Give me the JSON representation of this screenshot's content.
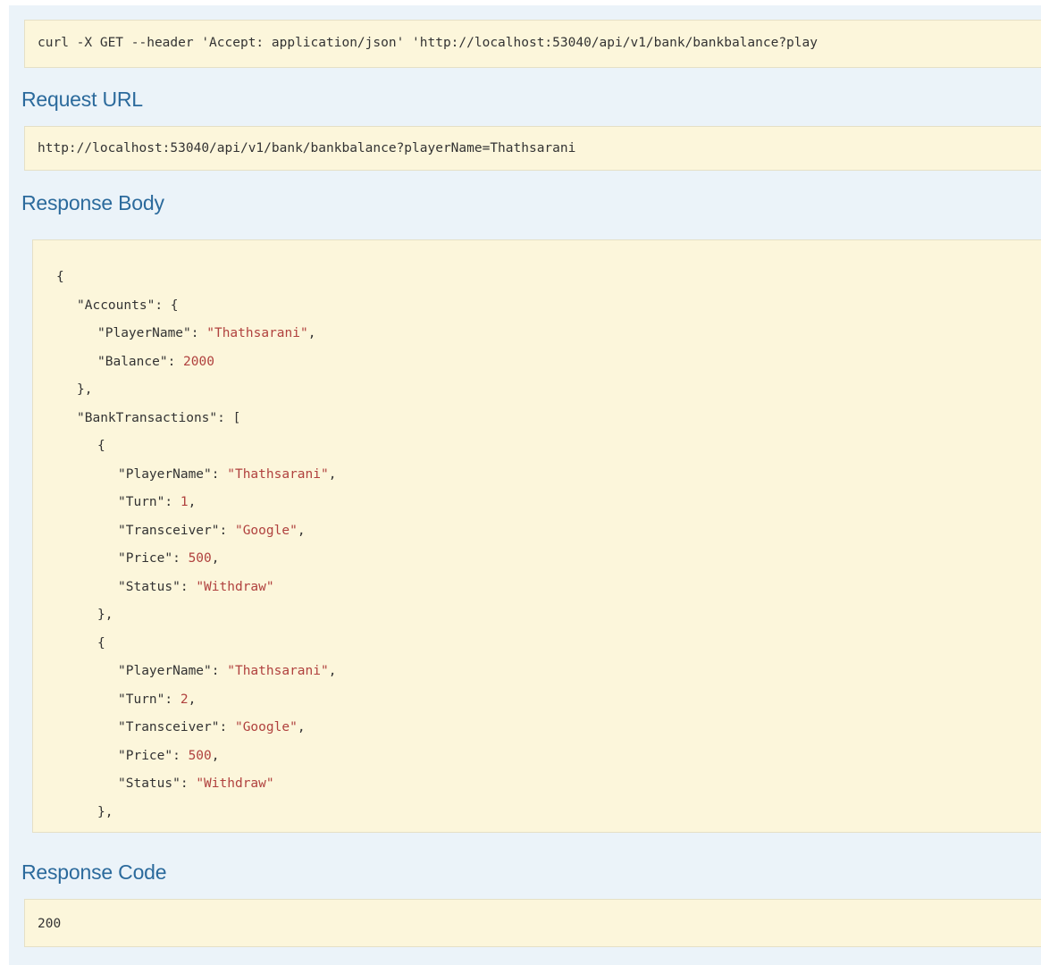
{
  "curl": {
    "command": "curl -X GET --header 'Accept: application/json' 'http://localhost:53040/api/v1/bank/bankbalance?play"
  },
  "request_url": {
    "title": "Request URL",
    "value": "http://localhost:53040/api/v1/bank/bankbalance?playerName=Thathsarani"
  },
  "response_body": {
    "title": "Response Body",
    "lines": [
      {
        "indent": 0,
        "tokens": [
          {
            "t": "p",
            "v": "{"
          }
        ]
      },
      {
        "indent": 1,
        "tokens": [
          {
            "t": "k",
            "v": "\"Accounts\""
          },
          {
            "t": "p",
            "v": ": {"
          }
        ]
      },
      {
        "indent": 2,
        "tokens": [
          {
            "t": "k",
            "v": "\"PlayerName\""
          },
          {
            "t": "p",
            "v": ": "
          },
          {
            "t": "s",
            "v": "\"Thathsarani\""
          },
          {
            "t": "p",
            "v": ","
          }
        ]
      },
      {
        "indent": 2,
        "tokens": [
          {
            "t": "k",
            "v": "\"Balance\""
          },
          {
            "t": "p",
            "v": ": "
          },
          {
            "t": "n",
            "v": "2000"
          }
        ]
      },
      {
        "indent": 1,
        "tokens": [
          {
            "t": "p",
            "v": "},"
          }
        ]
      },
      {
        "indent": 1,
        "tokens": [
          {
            "t": "k",
            "v": "\"BankTransactions\""
          },
          {
            "t": "p",
            "v": ": ["
          }
        ]
      },
      {
        "indent": 2,
        "tokens": [
          {
            "t": "p",
            "v": "{"
          }
        ]
      },
      {
        "indent": 3,
        "tokens": [
          {
            "t": "k",
            "v": "\"PlayerName\""
          },
          {
            "t": "p",
            "v": ": "
          },
          {
            "t": "s",
            "v": "\"Thathsarani\""
          },
          {
            "t": "p",
            "v": ","
          }
        ]
      },
      {
        "indent": 3,
        "tokens": [
          {
            "t": "k",
            "v": "\"Turn\""
          },
          {
            "t": "p",
            "v": ": "
          },
          {
            "t": "n",
            "v": "1"
          },
          {
            "t": "p",
            "v": ","
          }
        ]
      },
      {
        "indent": 3,
        "tokens": [
          {
            "t": "k",
            "v": "\"Transceiver\""
          },
          {
            "t": "p",
            "v": ": "
          },
          {
            "t": "s",
            "v": "\"Google\""
          },
          {
            "t": "p",
            "v": ","
          }
        ]
      },
      {
        "indent": 3,
        "tokens": [
          {
            "t": "k",
            "v": "\"Price\""
          },
          {
            "t": "p",
            "v": ": "
          },
          {
            "t": "n",
            "v": "500"
          },
          {
            "t": "p",
            "v": ","
          }
        ]
      },
      {
        "indent": 3,
        "tokens": [
          {
            "t": "k",
            "v": "\"Status\""
          },
          {
            "t": "p",
            "v": ": "
          },
          {
            "t": "s",
            "v": "\"Withdraw\""
          }
        ]
      },
      {
        "indent": 2,
        "tokens": [
          {
            "t": "p",
            "v": "},"
          }
        ]
      },
      {
        "indent": 2,
        "tokens": [
          {
            "t": "p",
            "v": "{"
          }
        ]
      },
      {
        "indent": 3,
        "tokens": [
          {
            "t": "k",
            "v": "\"PlayerName\""
          },
          {
            "t": "p",
            "v": ": "
          },
          {
            "t": "s",
            "v": "\"Thathsarani\""
          },
          {
            "t": "p",
            "v": ","
          }
        ]
      },
      {
        "indent": 3,
        "tokens": [
          {
            "t": "k",
            "v": "\"Turn\""
          },
          {
            "t": "p",
            "v": ": "
          },
          {
            "t": "n",
            "v": "2"
          },
          {
            "t": "p",
            "v": ","
          }
        ]
      },
      {
        "indent": 3,
        "tokens": [
          {
            "t": "k",
            "v": "\"Transceiver\""
          },
          {
            "t": "p",
            "v": ": "
          },
          {
            "t": "s",
            "v": "\"Google\""
          },
          {
            "t": "p",
            "v": ","
          }
        ]
      },
      {
        "indent": 3,
        "tokens": [
          {
            "t": "k",
            "v": "\"Price\""
          },
          {
            "t": "p",
            "v": ": "
          },
          {
            "t": "n",
            "v": "500"
          },
          {
            "t": "p",
            "v": ","
          }
        ]
      },
      {
        "indent": 3,
        "tokens": [
          {
            "t": "k",
            "v": "\"Status\""
          },
          {
            "t": "p",
            "v": ": "
          },
          {
            "t": "s",
            "v": "\"Withdraw\""
          }
        ]
      },
      {
        "indent": 2,
        "tokens": [
          {
            "t": "p",
            "v": "},"
          }
        ]
      }
    ]
  },
  "response_code": {
    "title": "Response Code",
    "value": "200"
  },
  "colors": {
    "panel_background": "#ebf3f9",
    "code_background": "#fcf6db",
    "title_color": "#2b6a9c",
    "json_value_color": "#b0413e"
  }
}
